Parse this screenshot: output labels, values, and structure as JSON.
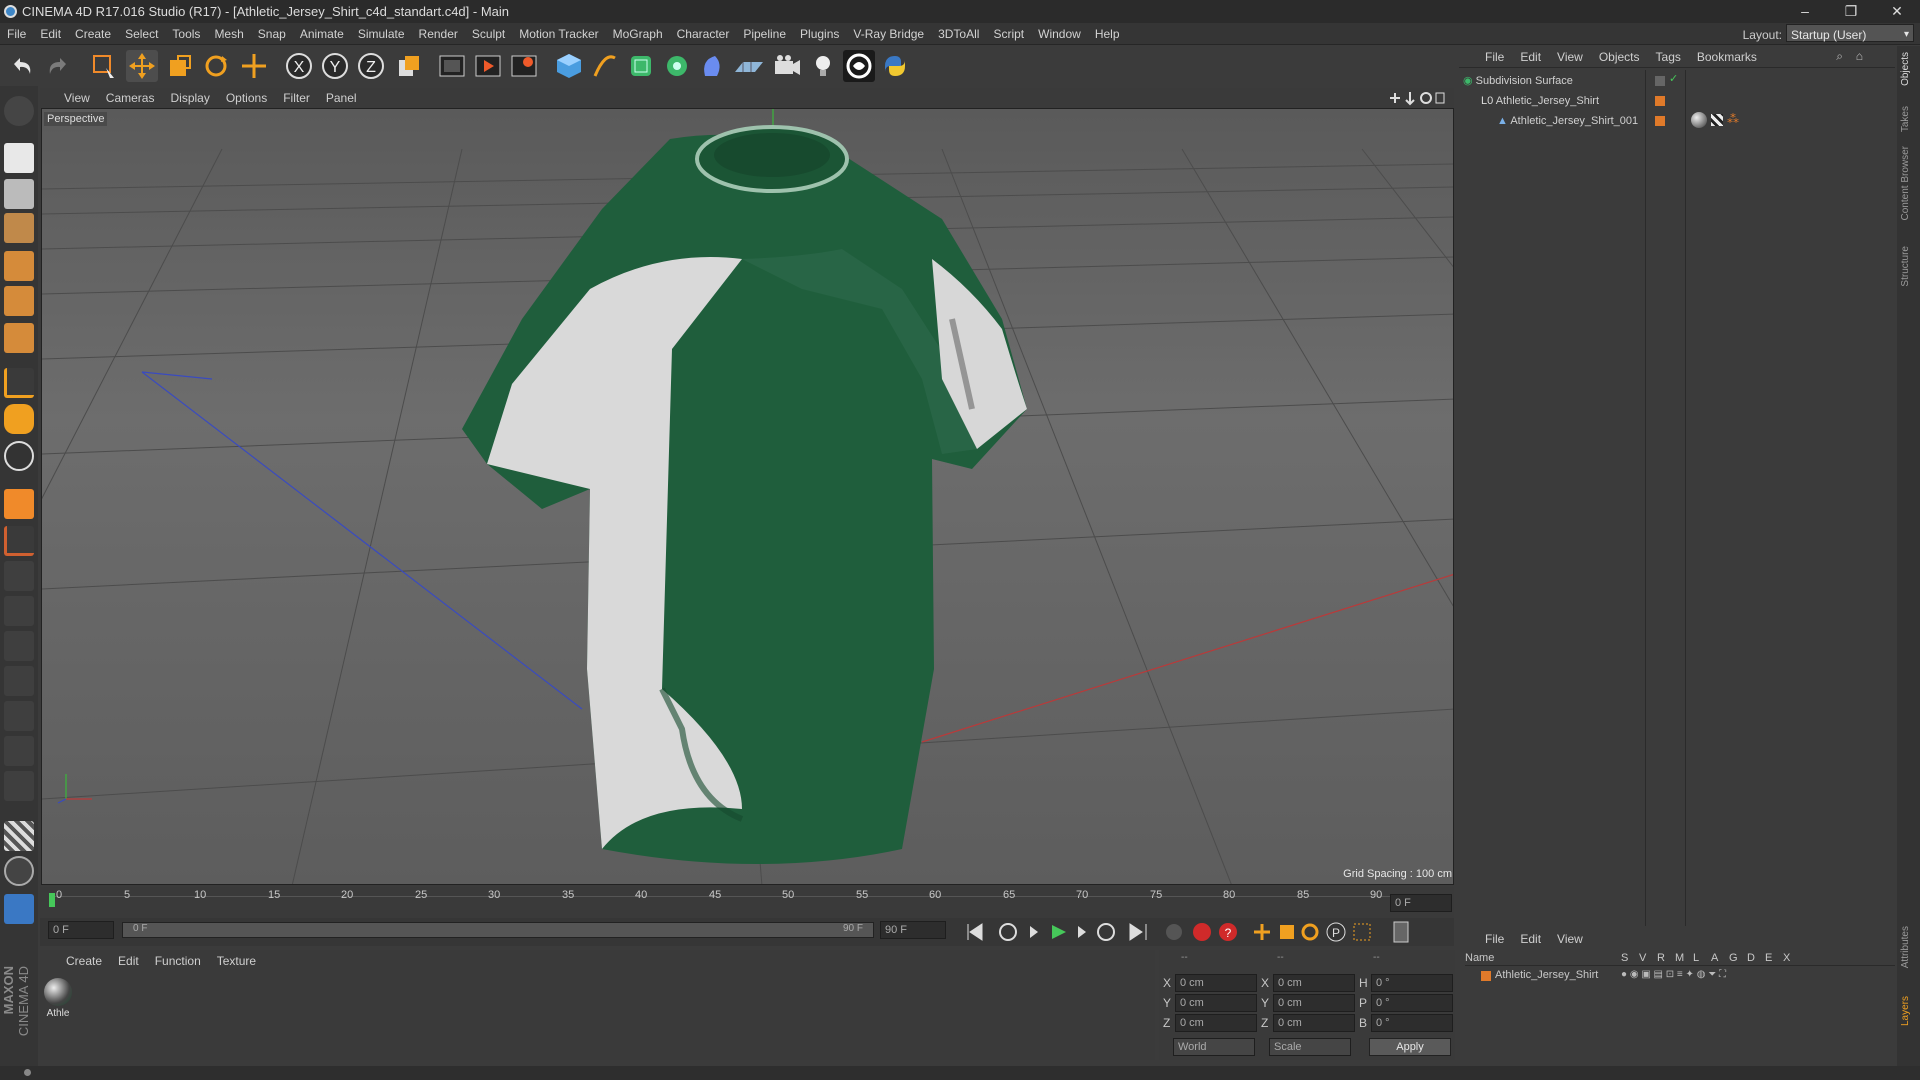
{
  "window": {
    "title": "CINEMA 4D R17.016 Studio (R17) - [Athletic_Jersey_Shirt_c4d_standart.c4d] - Main",
    "controls": [
      "–",
      "❐",
      "✕"
    ]
  },
  "menu": [
    "File",
    "Edit",
    "Create",
    "Select",
    "Tools",
    "Mesh",
    "Snap",
    "Animate",
    "Simulate",
    "Render",
    "Sculpt",
    "Motion Tracker",
    "MoGraph",
    "Character",
    "Pipeline",
    "Plugins",
    "V-Ray Bridge",
    "3DToAll",
    "Script",
    "Window",
    "Help"
  ],
  "layout": {
    "label": "Layout:",
    "value": "Startup (User)"
  },
  "toolbar": {
    "icons": [
      "undo-icon",
      "redo-icon",
      "select-icon",
      "move-icon",
      "scale-icon",
      "rotate-icon",
      "transform-icon",
      "x-axis-icon",
      "y-axis-icon",
      "z-axis-icon",
      "coordinate-system-icon",
      "render-view-icon",
      "render-picture-viewer-icon",
      "edit-render-settings-icon",
      "cube-icon",
      "pen-icon",
      "subdivision-icon",
      "array-icon",
      "deformer-icon",
      "floor-icon",
      "camera-icon",
      "light-icon",
      "vray-icon",
      "python-icon"
    ],
    "axis_labels": [
      "X",
      "Y",
      "Z"
    ]
  },
  "viewport": {
    "menu": [
      "View",
      "Cameras",
      "Display",
      "Options",
      "Filter",
      "Panel"
    ],
    "label": "Perspective",
    "grid_spacing": "Grid Spacing : 100 cm"
  },
  "timeline": {
    "ticks": [
      "0",
      "5",
      "10",
      "15",
      "20",
      "25",
      "30",
      "35",
      "40",
      "45",
      "50",
      "55",
      "60",
      "65",
      "70",
      "75",
      "80",
      "85",
      "90"
    ],
    "current_frame_right": "0 F",
    "start_frame": "0 F",
    "range_start": "0 F",
    "range_end": "90 F",
    "end_frame": "90 F"
  },
  "materials": {
    "menu": [
      "Create",
      "Edit",
      "Function",
      "Texture"
    ],
    "items": [
      {
        "name": "Athle"
      }
    ]
  },
  "coordinates": {
    "headers": [
      "--",
      "--",
      "--"
    ],
    "rows": [
      {
        "axis": "X",
        "pos": "0 cm",
        "size_axis": "X",
        "size": "0 cm",
        "rot_axis": "H",
        "rot": "0 °"
      },
      {
        "axis": "Y",
        "pos": "0 cm",
        "size_axis": "Y",
        "size": "0 cm",
        "rot_axis": "P",
        "rot": "0 °"
      },
      {
        "axis": "Z",
        "pos": "0 cm",
        "size_axis": "Z",
        "size": "0 cm",
        "rot_axis": "B",
        "rot": "0 °"
      }
    ],
    "mode": "World",
    "scale": "Scale",
    "apply": "Apply"
  },
  "objects": {
    "menu": [
      "File",
      "Edit",
      "View",
      "Objects",
      "Tags",
      "Bookmarks"
    ],
    "tree": [
      {
        "name": "Subdivision Surface",
        "indent": 0
      },
      {
        "name": "Athletic_Jersey_Shirt",
        "indent": 1
      },
      {
        "name": "Athletic_Jersey_Shirt_001",
        "indent": 2
      }
    ]
  },
  "layers": {
    "menu": [
      "File",
      "Edit",
      "View"
    ],
    "columns": [
      "Name",
      "S",
      "V",
      "R",
      "M",
      "L",
      "A",
      "G",
      "D",
      "E",
      "X"
    ],
    "rows": [
      {
        "name": "Athletic_Jersey_Shirt",
        "color": "#e07a2a"
      }
    ]
  },
  "side_tabs": [
    "Objects",
    "Takes",
    "Content Browser",
    "Structure",
    "Attributes",
    "Layers"
  ],
  "brand": [
    "MAXON",
    "CINEMA 4D"
  ],
  "colors": {
    "accent": "#3e86c6",
    "jersey_green": "#1c5a3a",
    "layer_orange": "#e07a2a",
    "play_green": "#46c85a"
  }
}
